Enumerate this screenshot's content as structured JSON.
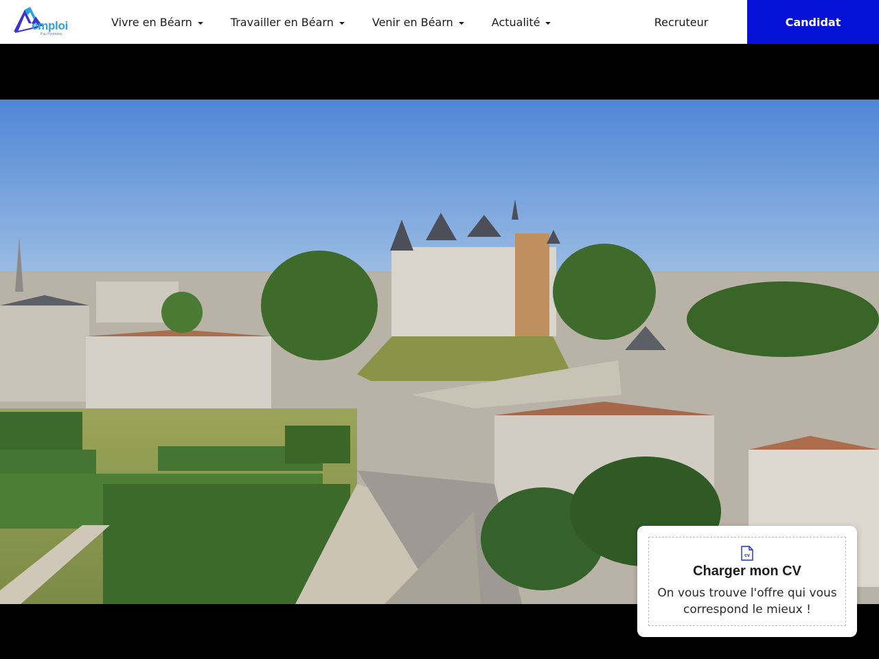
{
  "header": {
    "logo": {
      "icon": "mountain-logo-icon",
      "text": "emploi",
      "subtitle": "Pau Pyrénées",
      "colors": {
        "peak_dark": "#3b35c9",
        "peak_light": "#2aa3dc"
      }
    },
    "nav": [
      {
        "label": "Vivre en Béarn",
        "icon": "caret-down-icon"
      },
      {
        "label": "Travailler en Béarn",
        "icon": "caret-down-icon"
      },
      {
        "label": "Venir en Béarn",
        "icon": "caret-down-icon"
      },
      {
        "label": "Actualité",
        "icon": "caret-down-icon"
      }
    ],
    "recruteur_label": "Recruteur",
    "candidat_label": "Candidat",
    "accent_color": "#0613d6"
  },
  "hero": {
    "media": "aerial-video-frame-chateau-de-pau"
  },
  "cv_card": {
    "icon": "cv-file-icon",
    "icon_text": "cv",
    "title": "Charger mon CV",
    "description": "On vous trouve l'offre qui vous correspond le mieux !"
  }
}
